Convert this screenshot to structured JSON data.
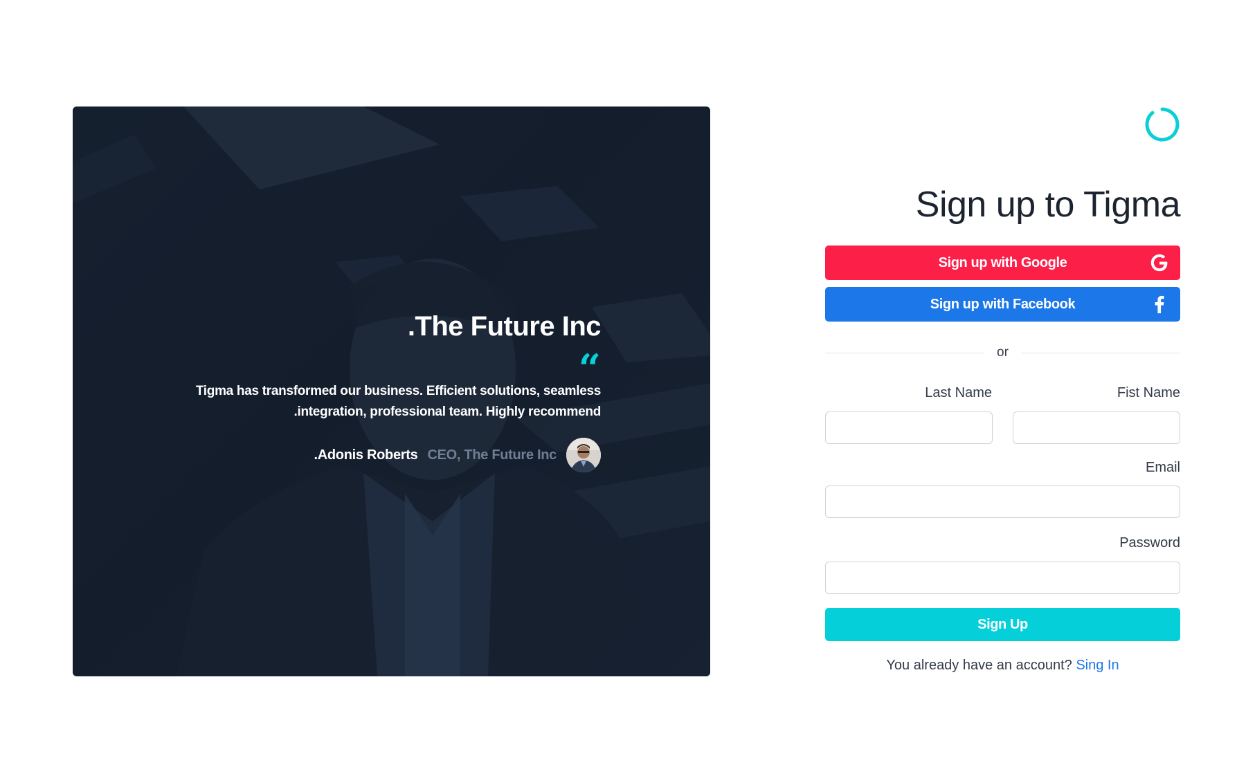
{
  "hero": {
    "company": ".The Future Inc",
    "quote_mark": "“",
    "quote_line_1": "Tigma has transformed our business. Efficient solutions, seamless",
    "quote_line_2": ".integration, professional team. Highly recommend",
    "author_name": ".Adonis Roberts",
    "author_role": "CEO, The Future Inc"
  },
  "form": {
    "title": "Sign up to Tigma",
    "google_label": "Sign up with Google",
    "facebook_label": "Sign up with Facebook",
    "divider_text": "or",
    "last_name_label": "Last Name",
    "first_name_label": "Fist Name",
    "email_label": "Email",
    "password_label": "Password",
    "last_name_value": "",
    "first_name_value": "",
    "email_value": "",
    "password_value": "",
    "submit_label": "Sign Up",
    "account_prompt": "You already have an account?",
    "signin_link": "Sing In"
  },
  "colors": {
    "accent": "#05d0da",
    "google": "#fc1f48",
    "facebook": "#1c77e8",
    "link": "#1c77e8",
    "hero_bg": "#17212f"
  },
  "icons": {
    "logo": "ring-logo-icon",
    "google": "google-icon",
    "facebook": "facebook-icon",
    "quote": "quote-icon"
  }
}
